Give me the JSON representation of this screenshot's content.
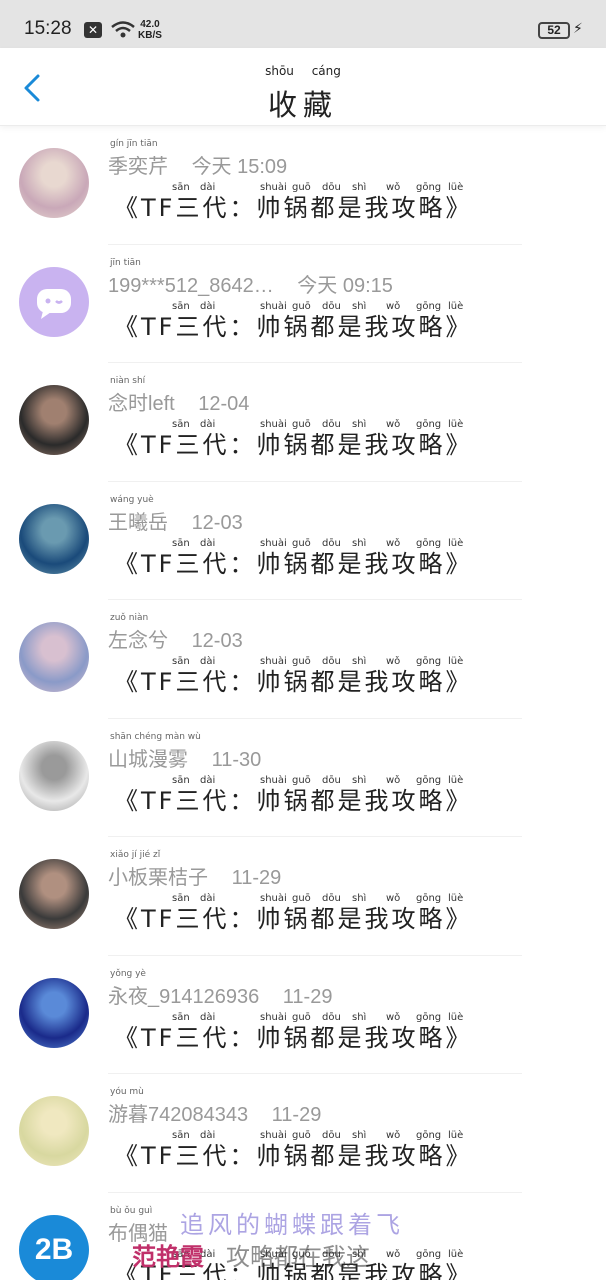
{
  "status_bar": {
    "time": "15:28",
    "net_speed_value": "42.0",
    "net_speed_unit": "KB/S",
    "battery": "52"
  },
  "header": {
    "title": "收藏",
    "title_ruby": "shōu cáng",
    "back_icon": "chevron-left-icon"
  },
  "items": [
    {
      "name": "季奕芹",
      "name_ruby": "   gín   jīn tiān",
      "time": "今天 15:09",
      "title": "《TF三代：帅锅都是我攻略》"
    },
    {
      "name": "199***512_8642…",
      "name_ruby": "                                          jīn tiān",
      "time": "今天 09:15",
      "title": "《TF三代：帅锅都是我攻略》"
    },
    {
      "name": "念时left",
      "name_ruby": "niàn shí",
      "time": "12-04",
      "title": "《TF三代：帅锅都是我攻略》"
    },
    {
      "name": "王曦岳",
      "name_ruby": "wáng         yuè",
      "time": "12-03",
      "title": "《TF三代：帅锅都是我攻略》"
    },
    {
      "name": "左念兮",
      "name_ruby": "zuǒ niàn",
      "time": "12-03",
      "title": "《TF三代：帅锅都是我攻略》"
    },
    {
      "name": "山城漫雾",
      "name_ruby": "shān chéng màn wù",
      "time": "11-30",
      "title": "《TF三代：帅锅都是我攻略》"
    },
    {
      "name": "小板栗桔子",
      "name_ruby": "xiǎo   jí       jié   zǐ",
      "time": "11-29",
      "title": "《TF三代：帅锅都是我攻略》"
    },
    {
      "name": "永夜_914126936",
      "name_ruby": "yǒng yè",
      "time": "11-29",
      "title": "《TF三代：帅锅都是我攻略》"
    },
    {
      "name": "游暮742084343",
      "name_ruby": "yóu mù",
      "time": "11-29",
      "title": "《TF三代：帅锅都是我攻略》"
    },
    {
      "name": "布偶猫",
      "name_ruby": "bù ǒu guì",
      "time": "",
      "title": "《TF三代：帅锅都是我攻略》"
    }
  ],
  "title_ruby": {
    "san": "sān",
    "dai": "dài",
    "shuai": "shuài",
    "guo": "guō",
    "dou": "dōu",
    "shi": "shì",
    "wo": "wǒ",
    "gong": "gōng",
    "lue": "lüè"
  },
  "avatars": [
    {
      "icon": "avatar-photo-icon",
      "c1": "#c9a8b8",
      "c2": "#e8d8d0"
    },
    {
      "icon": "chat-bubble-icon",
      "c1": "#c9b3f0",
      "c2": "#c9b3f0"
    },
    {
      "icon": "avatar-photo-icon",
      "c1": "#2a2a2a",
      "c2": "#a08070"
    },
    {
      "icon": "avatar-photo-icon",
      "c1": "#1a4a7a",
      "c2": "#6a9ab0"
    },
    {
      "icon": "avatar-photo-icon",
      "c1": "#8a9ac8",
      "c2": "#d8c0d0"
    },
    {
      "icon": "avatar-photo-icon",
      "c1": "#e8e8e8",
      "c2": "#9a9a9a"
    },
    {
      "icon": "avatar-photo-icon",
      "c1": "#3a3a3a",
      "c2": "#b09080"
    },
    {
      "icon": "avatar-photo-icon",
      "c1": "#1a2a8a",
      "c2": "#5a8ad8"
    },
    {
      "icon": "avatar-photo-icon",
      "c1": "#d8d8a0",
      "c2": "#f0e8c0"
    },
    {
      "icon": "avatar-badge-icon",
      "c1": "#1a8ad8",
      "c2": "#3aa8e8"
    }
  ],
  "avatar_badge_text": "2B",
  "overlay": {
    "line1": "追风的蝴蝶跟着飞",
    "line2": "范艳霞",
    "line3": "攻略都在我这"
  },
  "colors": {
    "accent": "#1a8ad8"
  }
}
